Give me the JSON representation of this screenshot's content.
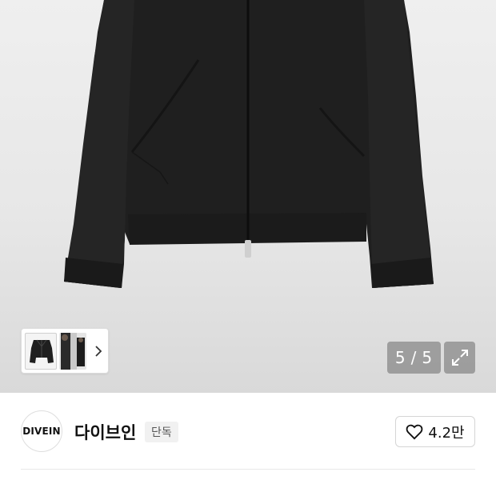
{
  "gallery": {
    "counter_current": "5",
    "counter_separator": "/",
    "counter_total": "5",
    "product_image_alt": "black zip-up jacket",
    "thumbnails": [
      "jacket-flat",
      "model-front"
    ],
    "expand_icon": "expand-arrows-icon",
    "next_icon": "chevron-right-icon"
  },
  "brand": {
    "logo_text": "DIVEIN",
    "name": "다이브인",
    "badge": "단독"
  },
  "like": {
    "icon": "heart-outline-icon",
    "count": "4.2만"
  },
  "colors": {
    "hero_bg": "#e8e8e8",
    "jacket": "#1e1e1e",
    "overlay": "#7a7a7a"
  }
}
